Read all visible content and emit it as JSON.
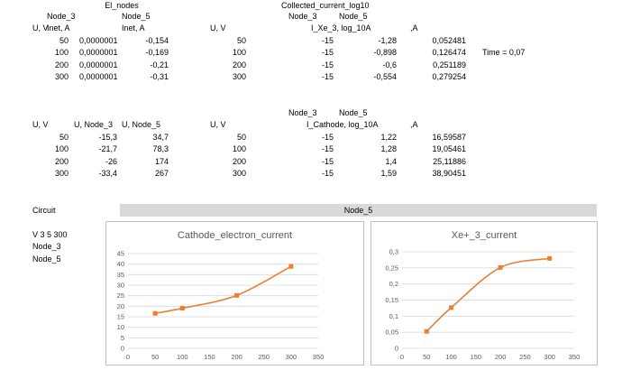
{
  "table1": {
    "title": "El_nodes",
    "node_headers": [
      "Node_3",
      "Node_5"
    ],
    "col_headers": [
      "U, V",
      "Inet, A",
      "Inet, A"
    ],
    "rows": [
      [
        "50",
        "0,0000001",
        "-0,154"
      ],
      [
        "100",
        "0,0000001",
        "-0,169"
      ],
      [
        "200",
        "0,0000001",
        "-0,21"
      ],
      [
        "300",
        "0,0000001",
        "-0,31"
      ]
    ]
  },
  "table2": {
    "title": "Collected_current_log10",
    "node_headers": [
      "Node_3",
      "Node_5"
    ],
    "col_headers": [
      "U, V",
      "I_Xe_3, log_10A",
      ",A"
    ],
    "rows": [
      [
        "50",
        "-15",
        "-1,28",
        "0,052481"
      ],
      [
        "100",
        "-15",
        "-0,898",
        "0,126474"
      ],
      [
        "200",
        "-15",
        "-0,6",
        "0,251189"
      ],
      [
        "300",
        "-15",
        "-0,554",
        "0,279254"
      ]
    ],
    "time_label": "Time = 0,07"
  },
  "table3": {
    "col_headers": [
      "U, V",
      "U, Node_3",
      "U, Node_5"
    ],
    "rows": [
      [
        "50",
        "-15,3",
        "34,7"
      ],
      [
        "100",
        "-21,7",
        "78,3"
      ],
      [
        "200",
        "-26",
        "174"
      ],
      [
        "300",
        "-33,4",
        "267"
      ]
    ]
  },
  "table4": {
    "node_headers": [
      "Node_3",
      "Node_5"
    ],
    "col_headers": [
      "U, V",
      "I_Cathode, log_10A",
      ",A"
    ],
    "rows": [
      [
        "50",
        "-15",
        "1,22",
        "16,59587"
      ],
      [
        "100",
        "-15",
        "1,28",
        "19,05461"
      ],
      [
        "200",
        "-15",
        "1,4",
        "25,11886"
      ],
      [
        "300",
        "-15",
        "1,59",
        "38,90451"
      ]
    ]
  },
  "circuit": {
    "label": "Circuit",
    "banner": "Node_5",
    "lines": [
      "V 3 5 300",
      "Node_3",
      "Node_5"
    ]
  },
  "chart_data": [
    {
      "type": "line",
      "title": "Cathode_electron_current",
      "x": [
        50,
        100,
        200,
        300
      ],
      "y": [
        16.59587,
        19.05461,
        25.11886,
        38.90451
      ],
      "xlim": [
        0,
        350
      ],
      "ylim": [
        0,
        45
      ],
      "xticks": [
        "0",
        "50",
        "100",
        "150",
        "200",
        "250",
        "300",
        "350"
      ],
      "yticks": [
        "0",
        "5",
        "10",
        "15",
        "20",
        "25",
        "30",
        "35",
        "40",
        "45"
      ],
      "color": "#ed7d31",
      "grid": true
    },
    {
      "type": "line",
      "title": "Xe+_3_current",
      "x": [
        50,
        100,
        200,
        300
      ],
      "y": [
        0.052481,
        0.126474,
        0.251189,
        0.279254
      ],
      "xlim": [
        0,
        350
      ],
      "ylim": [
        0,
        0.3
      ],
      "xticks": [
        "0",
        "50",
        "100",
        "150",
        "200",
        "250",
        "300",
        "350"
      ],
      "yticks": [
        "0",
        "0,05",
        "0,1",
        "0,15",
        "0,2",
        "0,25",
        "0,3"
      ],
      "color": "#ed7d31",
      "grid": true
    }
  ]
}
